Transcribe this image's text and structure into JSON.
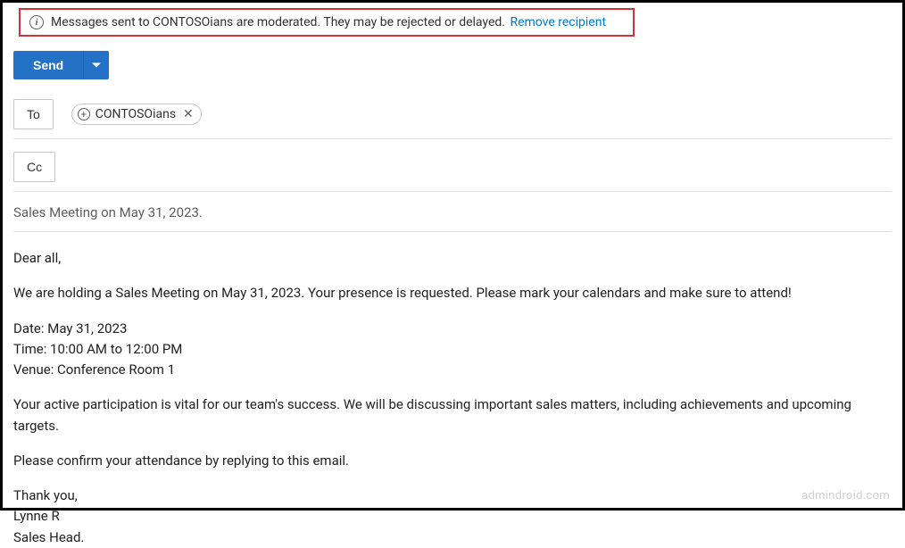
{
  "mailtip": {
    "text": "Messages sent to CONTOSOians are moderated. They may be rejected or delayed.",
    "link": "Remove recipient"
  },
  "send": {
    "label": "Send"
  },
  "recipients": {
    "to_label": "To",
    "cc_label": "Cc",
    "chip": {
      "name": "CONTOSOians",
      "icon_glyph": "+"
    }
  },
  "subject": "Sales Meeting on May 31, 2023.",
  "body": {
    "greeting": "Dear all,",
    "p1": "We are holding a Sales Meeting on May 31, 2023. Your presence is requested. Please mark your calendars and make sure to attend!",
    "date_line": "Date: May 31, 2023",
    "time_line": "Time: 10:00 AM to 12:00 PM",
    "venue_line": "Venue: Conference Room 1",
    "p2": "Your active participation is vital for our team's success. We will be discussing important sales matters, including achievements and upcoming targets.",
    "p3": "Please confirm your attendance by replying to this email.",
    "closing1": "Thank you,",
    "closing2": "Lynne R",
    "closing3": "Sales Head."
  },
  "watermark": "admindroid.com"
}
